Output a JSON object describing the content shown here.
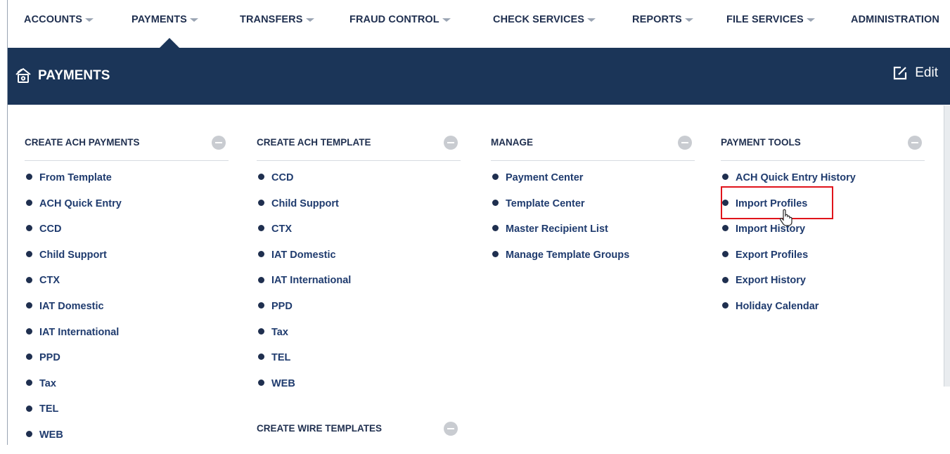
{
  "nav": {
    "items": [
      {
        "label": "ACCOUNTS"
      },
      {
        "label": "PAYMENTS"
      },
      {
        "label": "TRANSFERS"
      },
      {
        "label": "FRAUD CONTROL"
      },
      {
        "label": "CHECK SERVICES"
      },
      {
        "label": "REPORTS"
      },
      {
        "label": "FILE SERVICES"
      },
      {
        "label": "ADMINISTRATION"
      }
    ],
    "active": "PAYMENTS"
  },
  "header": {
    "title": "PAYMENTS",
    "title_icon": "payments-icon",
    "edit_label": "Edit",
    "edit_icon": "edit-icon"
  },
  "columns": [
    {
      "heading": "CREATE ACH PAYMENTS",
      "links": [
        "From Template",
        "ACH Quick Entry",
        "CCD",
        "Child Support",
        "CTX",
        "IAT Domestic",
        "IAT International",
        "PPD",
        "Tax",
        "TEL",
        "WEB"
      ]
    },
    {
      "heading": "CREATE ACH TEMPLATE",
      "links": [
        "CCD",
        "Child Support",
        "CTX",
        "IAT Domestic",
        "IAT International",
        "PPD",
        "Tax",
        "TEL",
        "WEB"
      ],
      "sub_heading": "CREATE WIRE TEMPLATES"
    },
    {
      "heading": "MANAGE",
      "links": [
        "Payment Center",
        "Template Center",
        "Master Recipient List",
        "Manage Template Groups"
      ]
    },
    {
      "heading": "PAYMENT TOOLS",
      "links": [
        "ACH Quick Entry History",
        "Import Profiles",
        "Import History",
        "Export Profiles",
        "Export History",
        "Holiday Calendar"
      ]
    }
  ],
  "highlighted_link": "Import Profiles",
  "colors": {
    "band": "#1b3558",
    "text": "#1f2f4f",
    "link": "#1f3b6e",
    "highlight": "#e0141b"
  }
}
